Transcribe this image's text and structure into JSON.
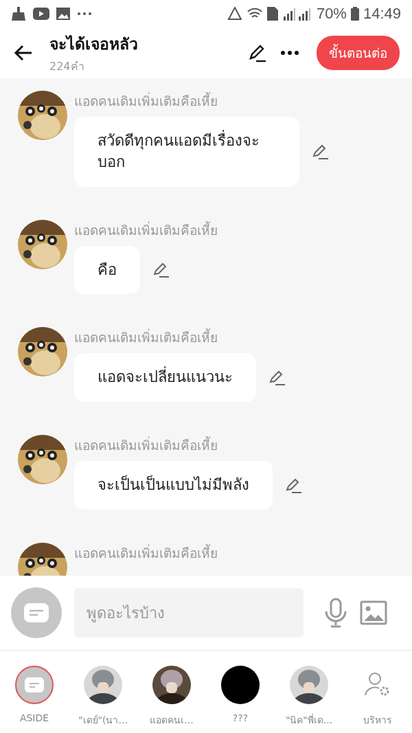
{
  "status_bar": {
    "battery": "70%",
    "time": "14:49"
  },
  "header": {
    "title": "จะได้เจอหลัว",
    "word_count": "224คำ",
    "next_button": "ขั้นตอนต่อ"
  },
  "messages": [
    {
      "author": "แอดคนเดิมเพิ่มเติมคือเหี้ย",
      "text": "สวัดดีทุกคนแอดมีเรื่องจะบอก"
    },
    {
      "author": "แอดคนเดิมเพิ่มเติมคือเหี้ย",
      "text": "คือ"
    },
    {
      "author": "แอดคนเดิมเพิ่มเติมคือเหี้ย",
      "text": "แอดจะเปลี่ยนแนวนะ"
    },
    {
      "author": "แอดคนเดิมเพิ่มเติมคือเหี้ย",
      "text": "จะเป็นเป็นแบบไม่มีพลัง"
    },
    {
      "author": "แอดคนเดิมเพิ่มเติมคือเหี้ย"
    }
  ],
  "composer": {
    "placeholder": "พูดอะไรบ้าง"
  },
  "characters": [
    {
      "kind": "aside",
      "label": "ASIDE",
      "selected": true
    },
    {
      "kind": "avatar",
      "label": "\"เดย์\"(นา...",
      "selected": false
    },
    {
      "kind": "avatar",
      "label": "แอดคนเ...",
      "selected": false
    },
    {
      "kind": "dark",
      "label": "???",
      "selected": false
    },
    {
      "kind": "avatar",
      "label": "\"นิค\"พี่เด...",
      "selected": false
    },
    {
      "kind": "manage",
      "label": "บริหาร",
      "selected": false
    }
  ]
}
